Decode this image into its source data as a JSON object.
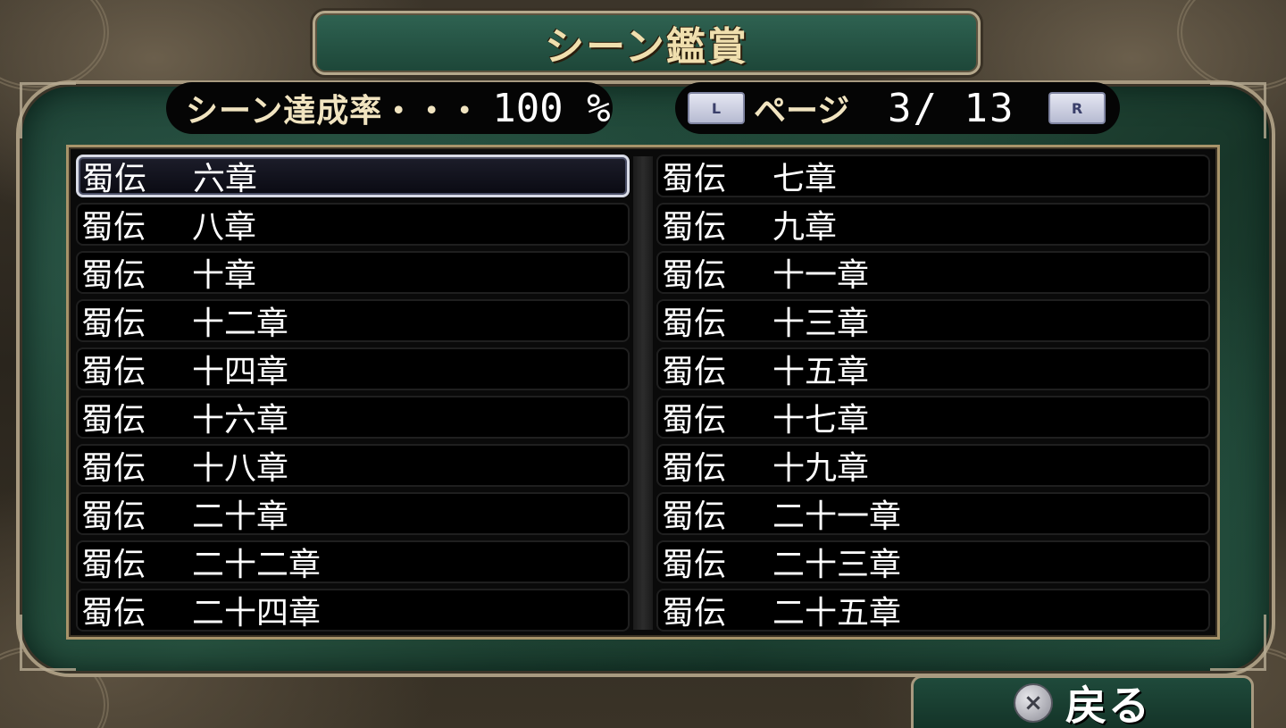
{
  "title": "シーン鑑賞",
  "rate": {
    "label": "シーン達成率・・・",
    "value": "100 %"
  },
  "pager": {
    "l_button": "L",
    "label": "ページ",
    "value": "3/ 13",
    "r_button": "R"
  },
  "list": {
    "left": [
      {
        "prefix": "蜀伝",
        "chapter": "六章",
        "selected": true
      },
      {
        "prefix": "蜀伝",
        "chapter": "八章"
      },
      {
        "prefix": "蜀伝",
        "chapter": "十章"
      },
      {
        "prefix": "蜀伝",
        "chapter": "十二章"
      },
      {
        "prefix": "蜀伝",
        "chapter": "十四章"
      },
      {
        "prefix": "蜀伝",
        "chapter": "十六章"
      },
      {
        "prefix": "蜀伝",
        "chapter": "十八章"
      },
      {
        "prefix": "蜀伝",
        "chapter": "二十章"
      },
      {
        "prefix": "蜀伝",
        "chapter": "二十二章"
      },
      {
        "prefix": "蜀伝",
        "chapter": "二十四章"
      }
    ],
    "right": [
      {
        "prefix": "蜀伝",
        "chapter": "七章"
      },
      {
        "prefix": "蜀伝",
        "chapter": "九章"
      },
      {
        "prefix": "蜀伝",
        "chapter": "十一章"
      },
      {
        "prefix": "蜀伝",
        "chapter": "十三章"
      },
      {
        "prefix": "蜀伝",
        "chapter": "十五章"
      },
      {
        "prefix": "蜀伝",
        "chapter": "十七章"
      },
      {
        "prefix": "蜀伝",
        "chapter": "十九章"
      },
      {
        "prefix": "蜀伝",
        "chapter": "二十一章"
      },
      {
        "prefix": "蜀伝",
        "chapter": "二十三章"
      },
      {
        "prefix": "蜀伝",
        "chapter": "二十五章"
      }
    ]
  },
  "back": {
    "icon": "cross-button-icon",
    "label": "戻る"
  },
  "colors": {
    "panel_green": "#24503f",
    "title_text": "#f0dfae",
    "frame_gold": "#a8946a"
  }
}
